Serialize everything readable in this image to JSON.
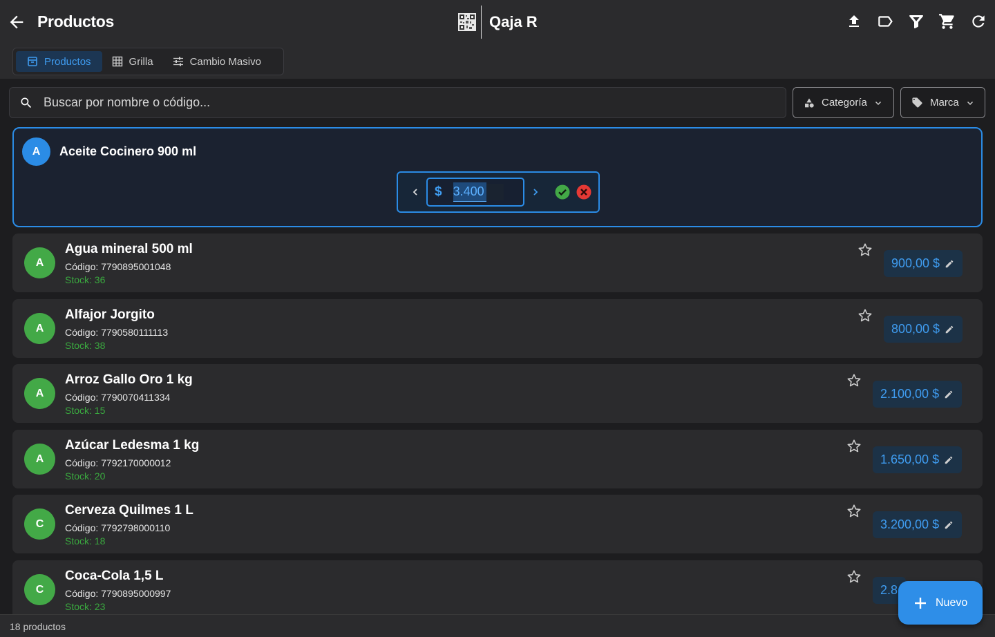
{
  "header": {
    "title": "Productos",
    "brand": "Qaja R",
    "actions": [
      "upload-icon",
      "label-icon",
      "filter-icon",
      "cart-icon",
      "refresh-icon"
    ]
  },
  "tabs": [
    {
      "label": "Productos",
      "icon": "box-icon",
      "active": true
    },
    {
      "label": "Grilla",
      "icon": "grid-icon",
      "active": false
    },
    {
      "label": "Cambio Masivo",
      "icon": "sliders-icon",
      "active": false
    }
  ],
  "search": {
    "placeholder": "Buscar por nombre o código..."
  },
  "filters": {
    "category": "Categoría",
    "brand": "Marca"
  },
  "editing": {
    "initial": "A",
    "name": "Aceite Cocinero 900 ml",
    "currency": "$",
    "value": "3.400"
  },
  "products": [
    {
      "initial": "A",
      "name": "Agua mineral 500 ml",
      "code": "Código: 7790895001048",
      "stock": "Stock: 36",
      "price": "900,00 $"
    },
    {
      "initial": "A",
      "name": "Alfajor Jorgito",
      "code": "Código: 7790580111113",
      "stock": "Stock: 38",
      "price": "800,00 $"
    },
    {
      "initial": "A",
      "name": "Arroz Gallo Oro 1 kg",
      "code": "Código: 7790070411334",
      "stock": "Stock: 15",
      "price": "2.100,00 $"
    },
    {
      "initial": "A",
      "name": "Azúcar Ledesma 1 kg",
      "code": "Código: 7792170000012",
      "stock": "Stock: 20",
      "price": "1.650,00 $"
    },
    {
      "initial": "C",
      "name": "Cerveza Quilmes 1 L",
      "code": "Código: 7792798000110",
      "stock": "Stock: 18",
      "price": "3.200,00 $"
    },
    {
      "initial": "C",
      "name": "Coca-Cola 1,5 L",
      "code": "Código: 7790895000997",
      "stock": "Stock: 23",
      "price": "2.8"
    }
  ],
  "footer": {
    "count": "18 productos"
  },
  "fab": {
    "label": "Nuevo"
  },
  "colors": {
    "accent": "#2e8ee8",
    "avatar": "#43a947",
    "stock": "#3aa83f",
    "ok": "#43a947",
    "cancel": "#e53935"
  }
}
